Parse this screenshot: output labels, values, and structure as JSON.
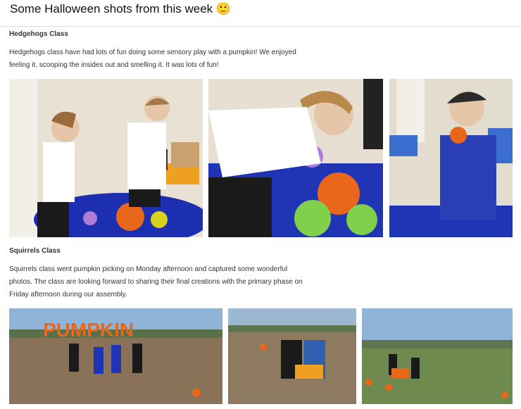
{
  "post": {
    "title": "Some Halloween shots from this week",
    "emoji": "🙂"
  },
  "sections": [
    {
      "heading": "Hedgehogs Class",
      "text": "Hedgehogs class have had lots of fun doing some sensory play with a pumpkin! We enjoyed feeling it, scooping the insides out and smelling it. It was lots of fun!",
      "photos": [
        {
          "description": "two children at blue sensory tray with pumpkin"
        },
        {
          "description": "girl scooping inside of pumpkin"
        },
        {
          "description": "boy smelling pumpkin"
        }
      ]
    },
    {
      "heading": "Squirrels Class",
      "text": "Squirrels class went pumpkin picking on Monday afternoon and captured some wonderful photos. The class are looking forward to sharing their final creations with the primary phase on Friday afternoon during our assembly.",
      "photos": [
        {
          "description": "children in pumpkin field under PUMPKIN letters",
          "sign_text": "PUMPKIN"
        },
        {
          "description": "adult and child with wheelbarrow in field"
        },
        {
          "description": "children picking pumpkins in field"
        }
      ]
    }
  ],
  "colors": {
    "tray_blue": "#1c2fb0",
    "pumpkin_orange": "#e8671a",
    "sky_blue": "#8fb4d8",
    "field_brown": "#8a7258"
  }
}
